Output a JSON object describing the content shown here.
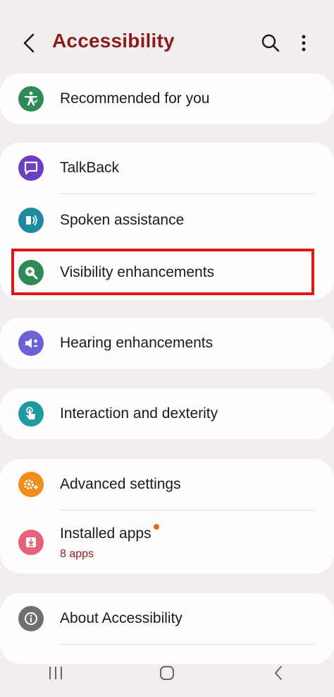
{
  "header": {
    "title": "Accessibility"
  },
  "sections": {
    "recommended": {
      "label": "Recommended for you"
    },
    "talkback": {
      "label": "TalkBack"
    },
    "spoken": {
      "label": "Spoken assistance"
    },
    "visibility": {
      "label": "Visibility enhancements"
    },
    "hearing": {
      "label": "Hearing enhancements"
    },
    "interaction": {
      "label": "Interaction and dexterity"
    },
    "advanced": {
      "label": "Advanced settings"
    },
    "installed": {
      "label": "Installed apps",
      "sublabel": "8 apps"
    },
    "about": {
      "label": "About Accessibility"
    }
  },
  "colors": {
    "title": "#8a1c1c",
    "recommended_icon": "#2e8b57",
    "talkback_icon": "#6a3fc1",
    "spoken_icon": "#1e8aa0",
    "visibility_icon": "#2e8b57",
    "hearing_icon": "#6b62d8",
    "interaction_icon": "#1e9aa0",
    "advanced_icon": "#f28c1a",
    "installed_icon": "#e3647a",
    "about_icon": "#6f6f6f",
    "highlight": "#e11515"
  }
}
